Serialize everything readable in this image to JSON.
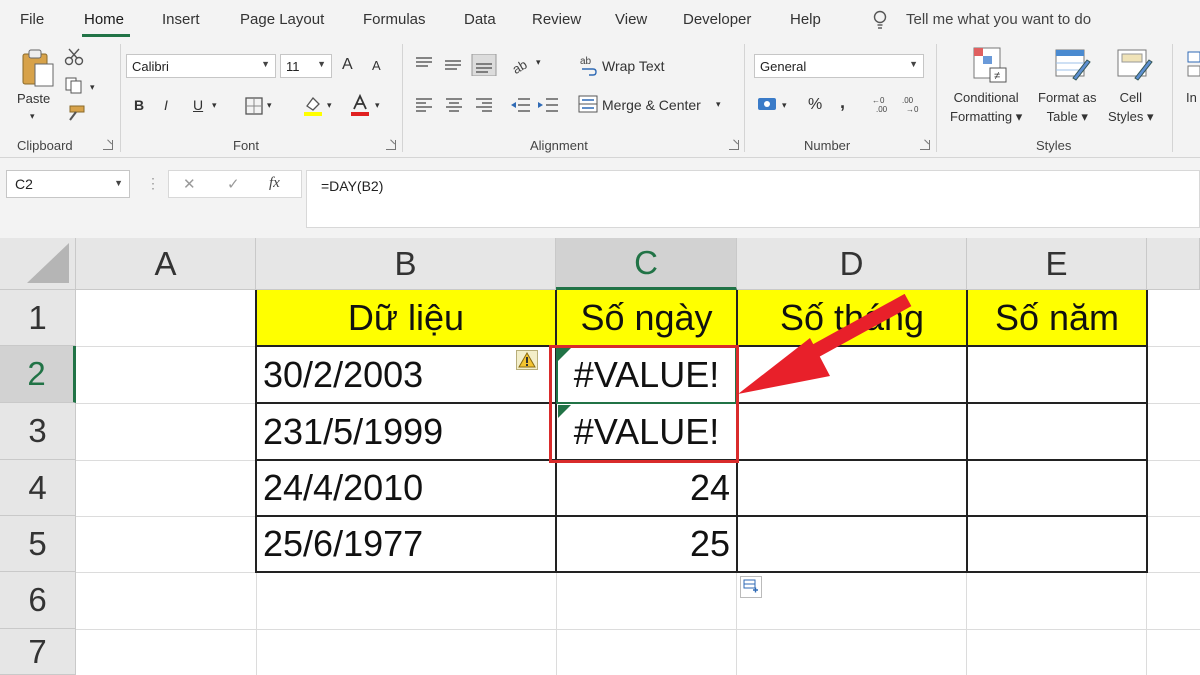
{
  "menu": {
    "tabs": [
      "File",
      "Home",
      "Insert",
      "Page Layout",
      "Formulas",
      "Data",
      "Review",
      "View",
      "Developer",
      "Help"
    ],
    "tell_me": "Tell me what you want to do"
  },
  "ribbon": {
    "clipboard": {
      "paste": "Paste",
      "label": "Clipboard"
    },
    "font": {
      "name": "Calibri",
      "size": "11",
      "bold": "B",
      "italic": "I",
      "underline": "U",
      "grow": "A",
      "shrink": "A",
      "label": "Font"
    },
    "alignment": {
      "wrap_text": "Wrap Text",
      "merge_center": "Merge & Center",
      "label": "Alignment"
    },
    "number": {
      "format": "General",
      "percent": "%",
      "comma": ",",
      "label": "Number"
    },
    "styles": {
      "conditional": [
        "Conditional",
        "Formatting"
      ],
      "format_as_table": [
        "Format as",
        "Table"
      ],
      "cell_styles": [
        "Cell",
        "Styles"
      ],
      "label": "Styles"
    },
    "insert_partial": "In"
  },
  "formula_bar": {
    "name_box": "C2",
    "cancel": "✕",
    "enter": "✓",
    "fx": "fx",
    "formula": "=DAY(B2)"
  },
  "grid": {
    "columns": [
      "A",
      "B",
      "C",
      "D",
      "E"
    ],
    "selected_column": "C",
    "rows": [
      "1",
      "2",
      "3",
      "4",
      "5",
      "6",
      "7"
    ],
    "selected_row": "2",
    "headers": {
      "b": "Dữ liệu",
      "c": "Số ngày",
      "d": "Số tháng",
      "e": "Số năm"
    },
    "b": [
      "30/2/2003",
      "231/5/1999",
      "24/4/2010",
      "25/6/1977"
    ],
    "c": [
      "#VALUE!",
      "#VALUE!",
      "24",
      "25"
    ]
  },
  "colors": {
    "accent": "#217346",
    "header_fill": "#ffff00",
    "highlight_box": "#d92b2b",
    "arrow": "#e8202a"
  }
}
